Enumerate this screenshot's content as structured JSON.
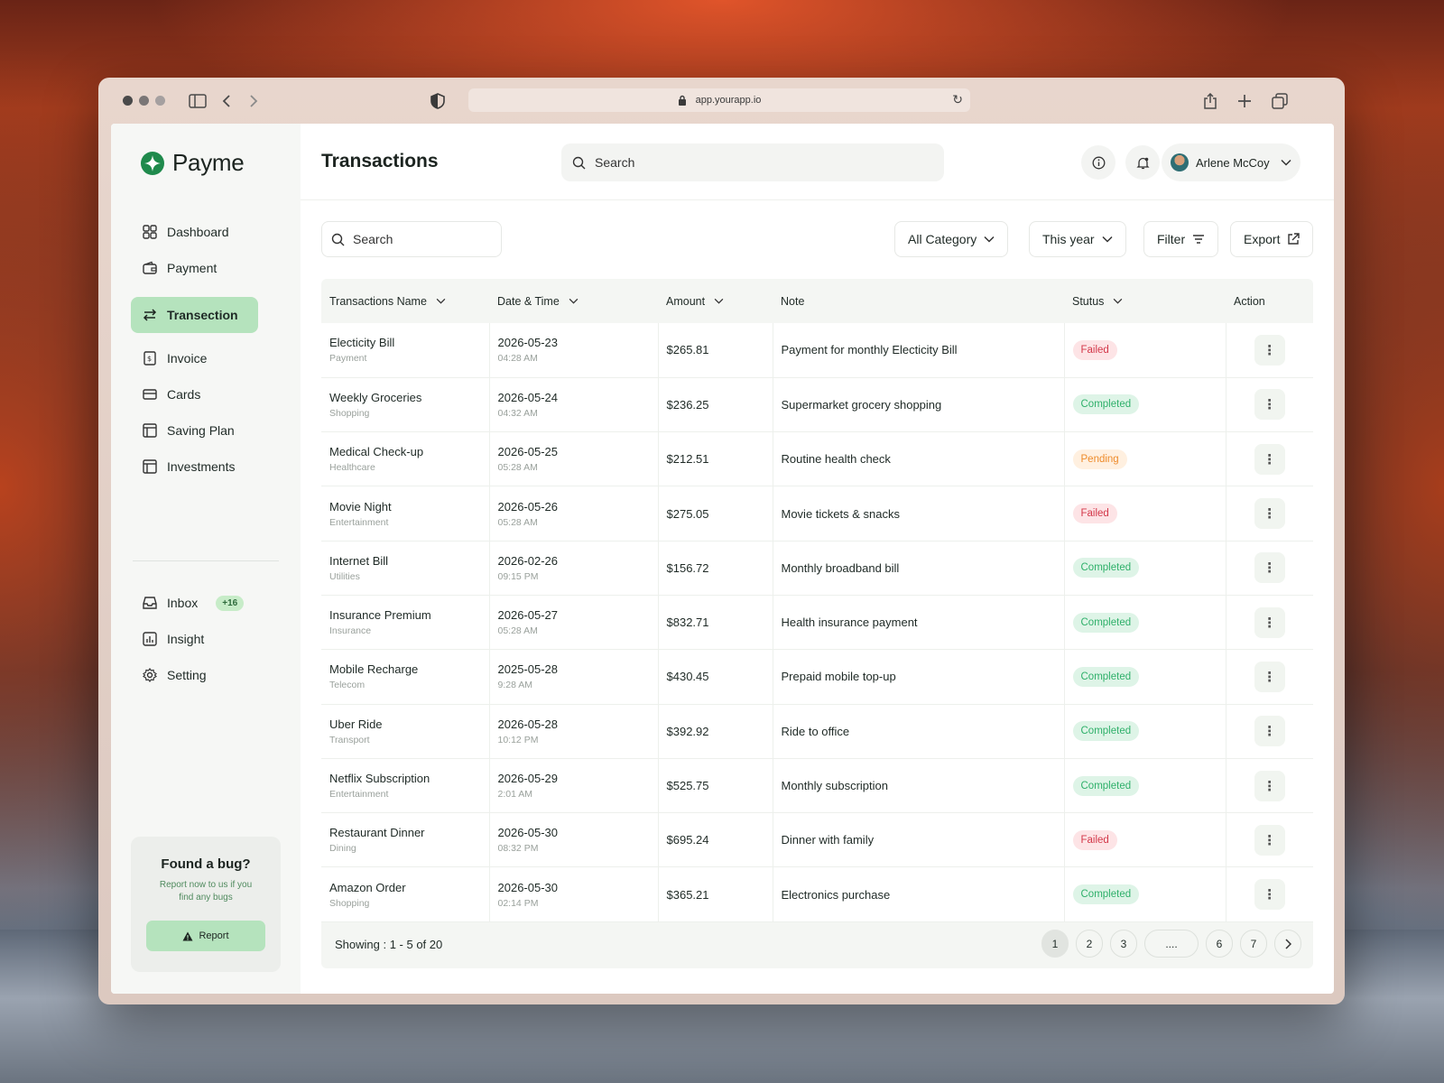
{
  "browser": {
    "url": "app.yourapp.io"
  },
  "app": {
    "name": "Payme",
    "page_title": "Transactions"
  },
  "sidebar": {
    "items": [
      {
        "label": "Dashboard",
        "icon": "grid-icon"
      },
      {
        "label": "Payment",
        "icon": "wallet-icon"
      },
      {
        "label": "Transection",
        "icon": "arrows-swap-icon",
        "active": true
      },
      {
        "label": "Invoice",
        "icon": "receipt-icon"
      },
      {
        "label": "Cards",
        "icon": "card-icon"
      },
      {
        "label": "Saving Plan",
        "icon": "layout-icon"
      },
      {
        "label": "Investments",
        "icon": "layout-icon"
      }
    ],
    "secondary": [
      {
        "label": "Inbox",
        "icon": "inbox-icon",
        "badge": "+16"
      },
      {
        "label": "Insight",
        "icon": "chart-icon"
      },
      {
        "label": "Setting",
        "icon": "gear-icon"
      }
    ],
    "bug_card": {
      "title": "Found a bug?",
      "text": "Report now to us if you find any bugs",
      "button": "Report"
    }
  },
  "header": {
    "search_placeholder": "Search",
    "user_name": "Arlene McCoy"
  },
  "filters": {
    "search_placeholder": "Search",
    "category": "All Category",
    "period": "This year",
    "filter_label": "Filter",
    "export_label": "Export"
  },
  "table": {
    "columns": [
      "Transactions Name",
      "Date & Time",
      "Amount",
      "Note",
      "Stutus",
      "Action"
    ],
    "rows": [
      {
        "name": "Electicity Bill",
        "category": "Payment",
        "date": "2026-05-23",
        "time": "04:28 AM",
        "amount": "$265.81",
        "note": "Payment for monthly Electicity Bill",
        "status": "Failed"
      },
      {
        "name": "Weekly Groceries",
        "category": "Shopping",
        "date": "2026-05-24",
        "time": "04:32 AM",
        "amount": "$236.25",
        "note": "Supermarket grocery shopping",
        "status": "Completed"
      },
      {
        "name": "Medical Check-up",
        "category": "Healthcare",
        "date": "2026-05-25",
        "time": "05:28 AM",
        "amount": "$212.51",
        "note": "Routine health check",
        "status": "Pending"
      },
      {
        "name": "Movie Night",
        "category": "Entertainment",
        "date": "2026-05-26",
        "time": "05:28 AM",
        "amount": "$275.05",
        "note": "Movie tickets & snacks",
        "status": "Failed"
      },
      {
        "name": "Internet Bill",
        "category": "Utilities",
        "date": "2026-02-26",
        "time": "09:15 PM",
        "amount": "$156.72",
        "note": "Monthly broadband bill",
        "status": "Completed"
      },
      {
        "name": "Insurance Premium",
        "category": "Insurance",
        "date": "2026-05-27",
        "time": "05:28 AM",
        "amount": "$832.71",
        "note": "Health insurance payment",
        "status": "Completed"
      },
      {
        "name": "Mobile Recharge",
        "category": "Telecom",
        "date": "2025-05-28",
        "time": "9:28 AM",
        "amount": "$430.45",
        "note": "Prepaid mobile top-up",
        "status": "Completed"
      },
      {
        "name": "Uber Ride",
        "category": "Transport",
        "date": "2026-05-28",
        "time": "10:12 PM",
        "amount": "$392.92",
        "note": "Ride to office",
        "status": "Completed"
      },
      {
        "name": "Netflix Subscription",
        "category": "Entertainment",
        "date": "2026-05-29",
        "time": "2:01 AM",
        "amount": "$525.75",
        "note": "Monthly subscription",
        "status": "Completed"
      },
      {
        "name": "Restaurant Dinner",
        "category": "Dining",
        "date": "2026-05-30",
        "time": "08:32 PM",
        "amount": "$695.24",
        "note": "Dinner with family",
        "status": "Failed"
      },
      {
        "name": "Amazon Order",
        "category": "Shopping",
        "date": "2026-05-30",
        "time": "02:14 PM",
        "amount": "$365.21",
        "note": "Electronics purchase",
        "status": "Completed"
      }
    ],
    "showing": "Showing : 1 - 5 of 20",
    "pages": [
      "1",
      "2",
      "3",
      "....",
      "6",
      "7"
    ],
    "current_page": "1"
  },
  "colors": {
    "accent": "#b5e3bd",
    "failed": "#d3384a",
    "completed": "#2fb06a",
    "pending": "#ee8c2c"
  }
}
